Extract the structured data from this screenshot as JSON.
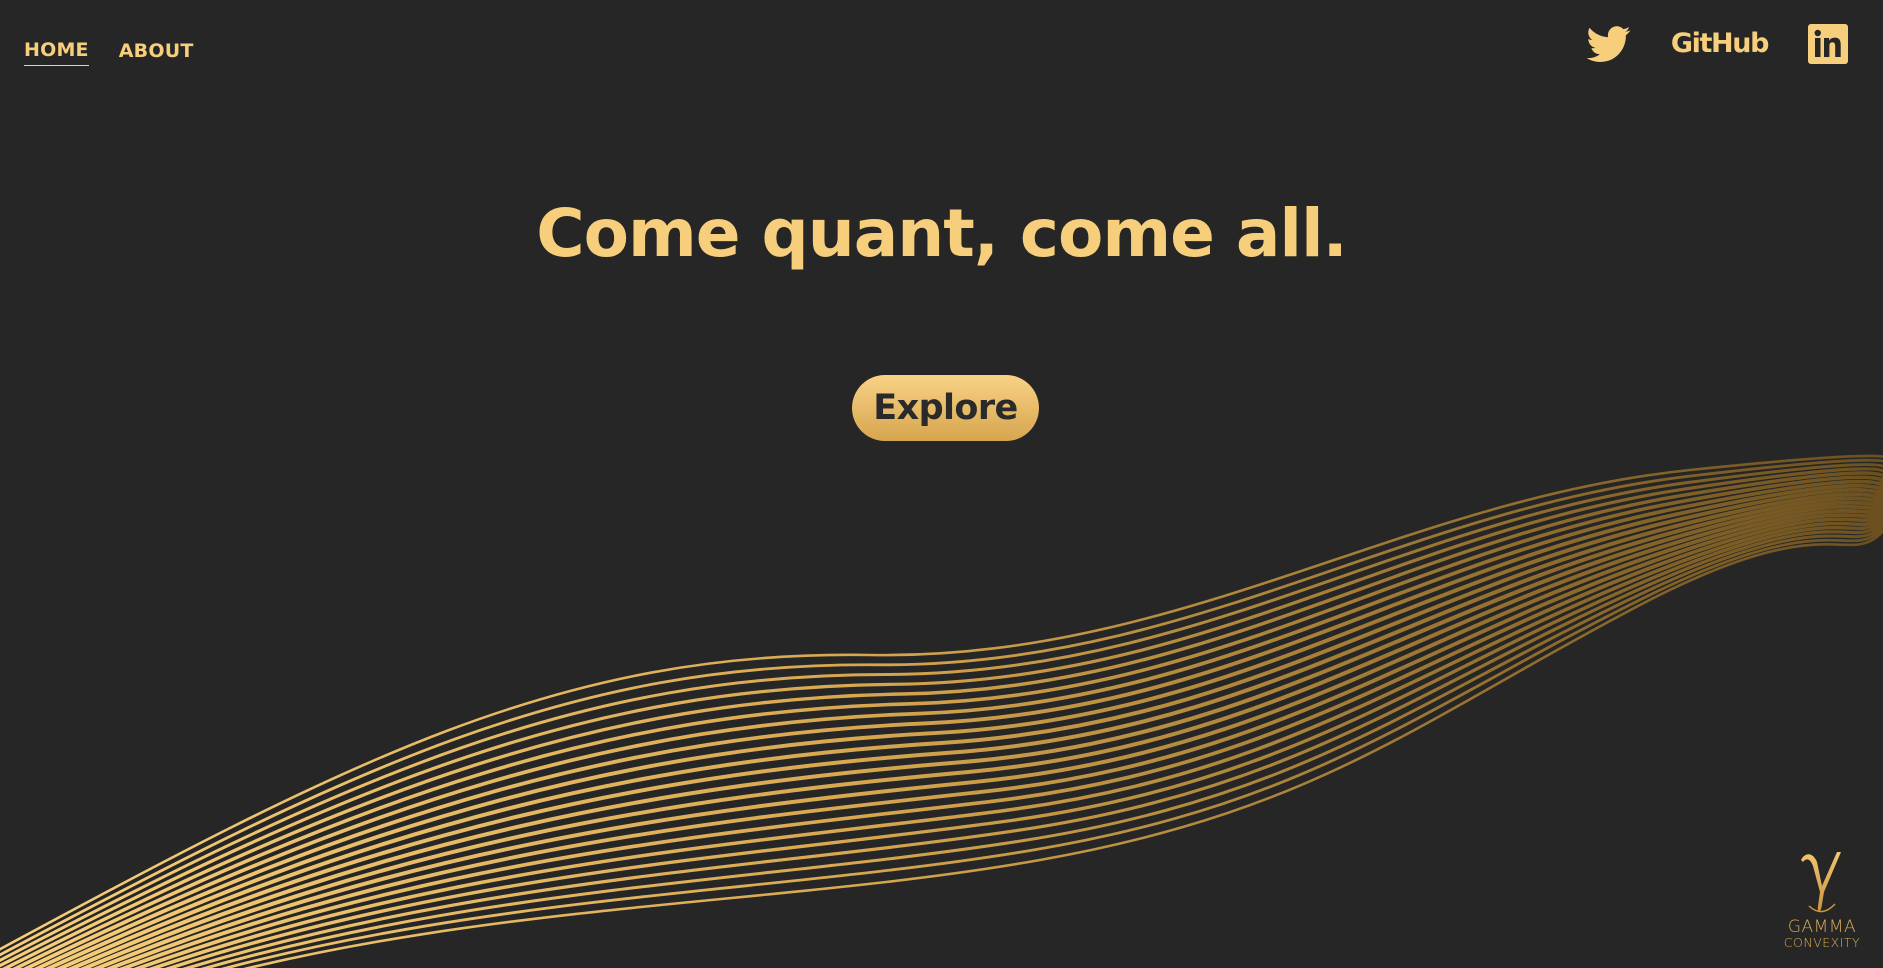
{
  "nav": {
    "items": [
      {
        "label": "HOME",
        "active": true
      },
      {
        "label": "ABOUT",
        "active": false
      }
    ]
  },
  "social": {
    "twitter_icon": "twitter-icon",
    "github_label": "GitHub",
    "linkedin_icon": "linkedin-icon"
  },
  "hero": {
    "title": "Come quant, come all.",
    "cta_label": "Explore"
  },
  "logo": {
    "symbol": "γ",
    "line1": "GAMMA",
    "line2": "CONVEXITY"
  },
  "colors": {
    "background": "#262626",
    "accent": "#f7cf7c",
    "accent_dark": "#d7a54f",
    "button_text": "#2a2a2a"
  }
}
